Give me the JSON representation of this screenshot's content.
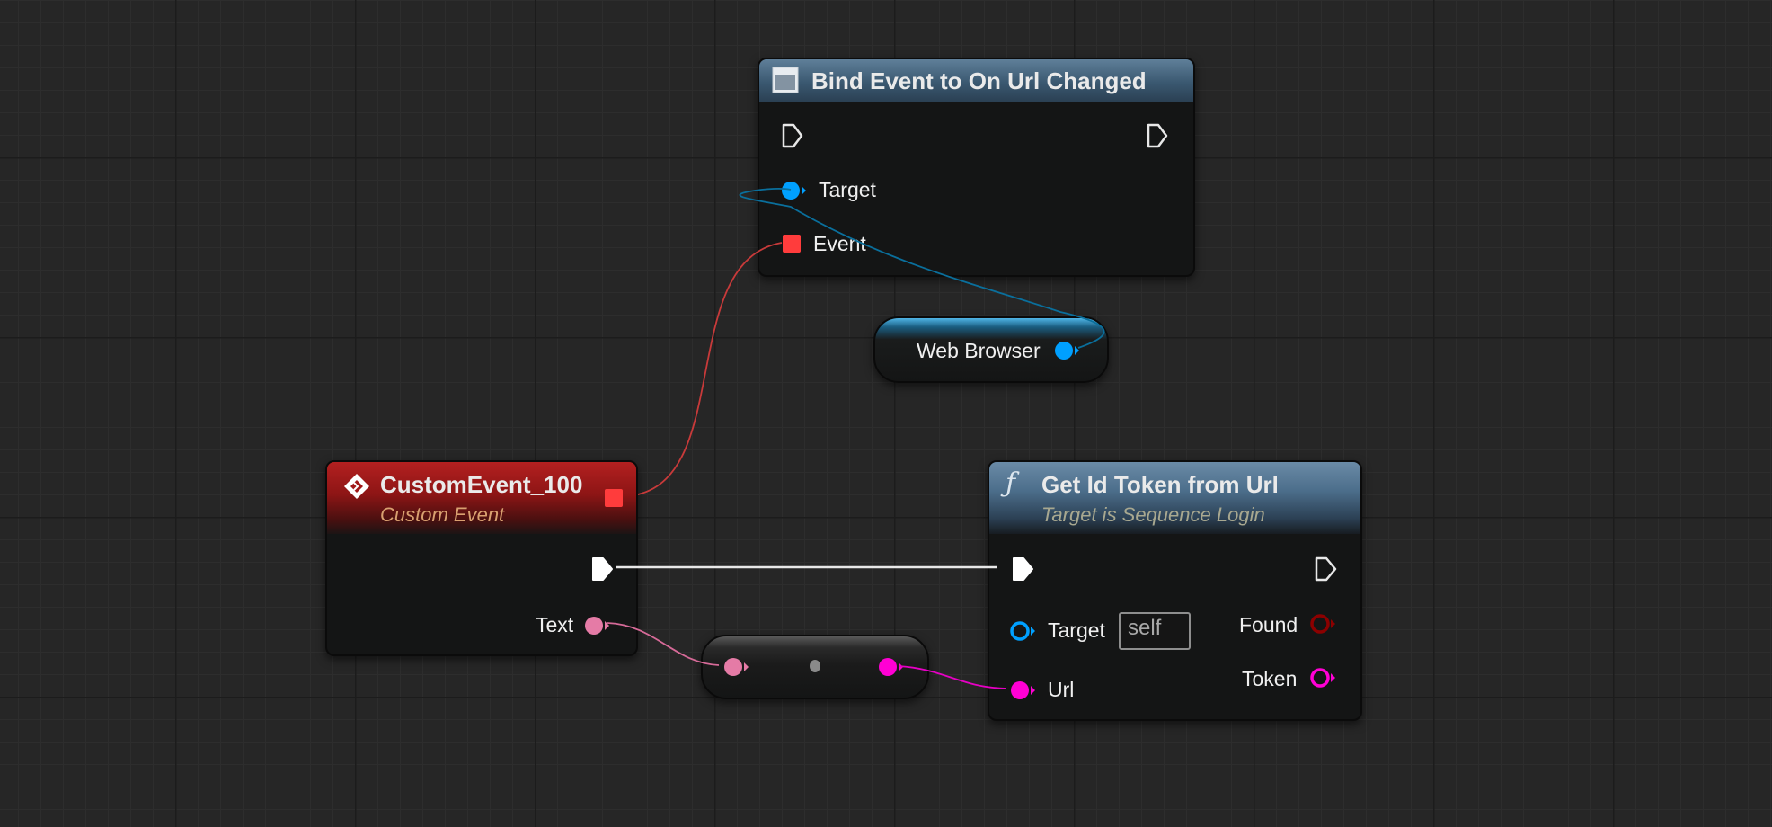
{
  "bind_node": {
    "title": "Bind Event to On Url Changed",
    "icon": "widget-icon",
    "pins": {
      "target": "Target",
      "event": "Event"
    }
  },
  "web_browser_node": {
    "label": "Web Browser"
  },
  "custom_event_node": {
    "title": "CustomEvent_100",
    "subtitle": "Custom Event",
    "icon": "event-diamond-icon",
    "pins": {
      "text": "Text"
    }
  },
  "conversion_node": {
    "label": ""
  },
  "get_token_node": {
    "title": "Get Id Token from Url",
    "subtitle": "Target is Sequence Login",
    "icon": "function-icon",
    "pins": {
      "target": "Target",
      "target_default": "self",
      "url": "Url",
      "found": "Found",
      "token": "Token"
    }
  },
  "colors": {
    "exec": "#ffffff",
    "object": "#00a0ff",
    "delegate": "#ff3c3c",
    "string": "#ff00d4",
    "text": "#e57ba6",
    "bool": "#8c0000",
    "event_header": "#8d1515",
    "function_header": "#4c6e8b"
  }
}
